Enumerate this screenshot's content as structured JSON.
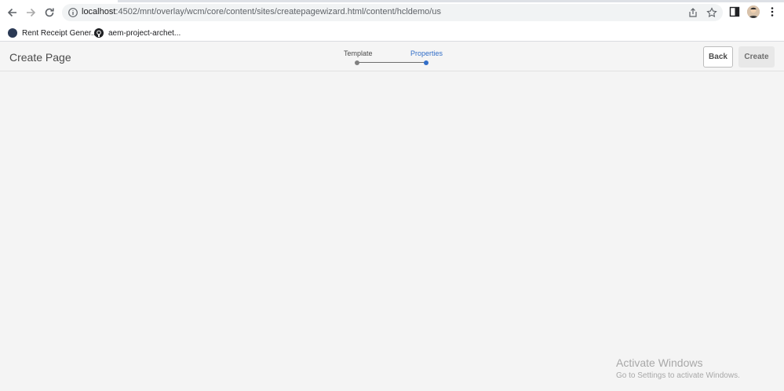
{
  "browser": {
    "url_host": "localhost",
    "url_path": ":4502/mnt/overlay/wcm/core/content/sites/createpagewizard.html/content/hcldemo/us",
    "bookmarks": [
      {
        "label": "Rent Receipt Gener..."
      },
      {
        "label": "aem-project-archet..."
      }
    ]
  },
  "header": {
    "title": "Create Page",
    "steps": [
      {
        "label": "Template"
      },
      {
        "label": "Properties"
      }
    ],
    "back_label": "Back",
    "create_label": "Create"
  },
  "watermark": {
    "title": "Activate Windows",
    "subtitle": "Go to Settings to activate Windows."
  },
  "colors": {
    "accent": "#326ec8",
    "background": "#f4f4f4"
  }
}
